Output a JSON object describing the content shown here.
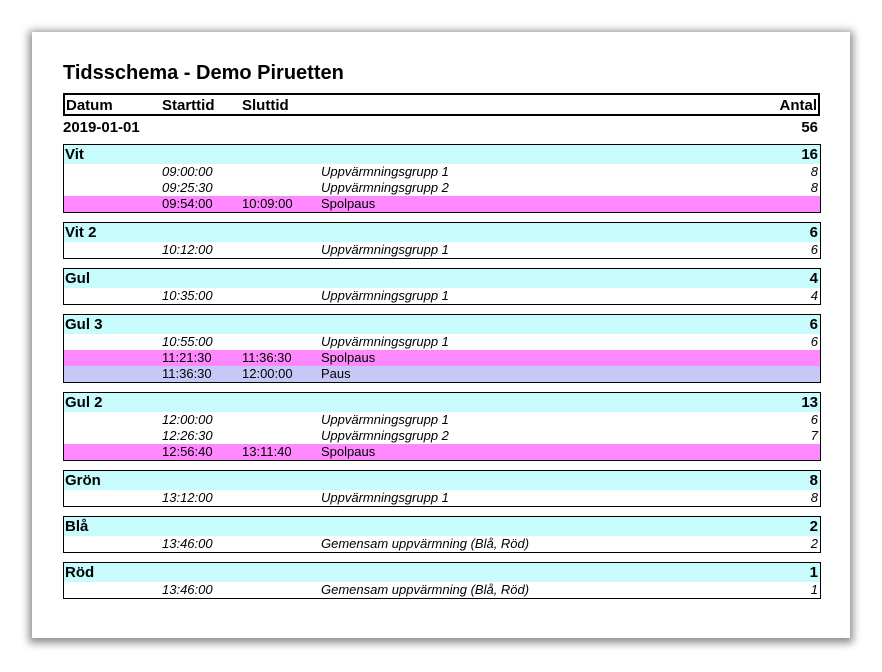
{
  "title": "Tidsschema - Demo Piruetten",
  "header": {
    "datum": "Datum",
    "starttid": "Starttid",
    "sluttid": "Sluttid",
    "antal": "Antal"
  },
  "date_row": {
    "date": "2019-01-01",
    "total": "56"
  },
  "groups": [
    {
      "name": "Vit",
      "count": "16",
      "rows": [
        {
          "kind": "warmup",
          "start": "09:00:00",
          "end": "",
          "desc": "Uppvärmningsgrupp 1",
          "num": "8"
        },
        {
          "kind": "warmup",
          "start": "09:25:30",
          "end": "",
          "desc": "Uppvärmningsgrupp 2",
          "num": "8"
        },
        {
          "kind": "spolpaus",
          "start": "09:54:00",
          "end": "10:09:00",
          "desc": "Spolpaus",
          "num": ""
        }
      ]
    },
    {
      "name": "Vit 2",
      "count": "6",
      "rows": [
        {
          "kind": "warmup",
          "start": "10:12:00",
          "end": "",
          "desc": "Uppvärmningsgrupp 1",
          "num": "6"
        }
      ]
    },
    {
      "name": "Gul",
      "count": "4",
      "rows": [
        {
          "kind": "warmup",
          "start": "10:35:00",
          "end": "",
          "desc": "Uppvärmningsgrupp 1",
          "num": "4"
        }
      ]
    },
    {
      "name": "Gul 3",
      "count": "6",
      "rows": [
        {
          "kind": "warmup",
          "start": "10:55:00",
          "end": "",
          "desc": "Uppvärmningsgrupp 1",
          "num": "6"
        },
        {
          "kind": "spolpaus",
          "start": "11:21:30",
          "end": "11:36:30",
          "desc": "Spolpaus",
          "num": ""
        },
        {
          "kind": "paus",
          "start": "11:36:30",
          "end": "12:00:00",
          "desc": "Paus",
          "num": ""
        }
      ]
    },
    {
      "name": "Gul 2",
      "count": "13",
      "rows": [
        {
          "kind": "warmup",
          "start": "12:00:00",
          "end": "",
          "desc": "Uppvärmningsgrupp 1",
          "num": "6"
        },
        {
          "kind": "warmup",
          "start": "12:26:30",
          "end": "",
          "desc": "Uppvärmningsgrupp 2",
          "num": "7"
        },
        {
          "kind": "spolpaus",
          "start": "12:56:40",
          "end": "13:11:40",
          "desc": "Spolpaus",
          "num": ""
        }
      ]
    },
    {
      "name": "Grön",
      "count": "8",
      "rows": [
        {
          "kind": "warmup",
          "start": "13:12:00",
          "end": "",
          "desc": "Uppvärmningsgrupp 1",
          "num": "8"
        }
      ]
    },
    {
      "name": "Blå",
      "count": "2",
      "rows": [
        {
          "kind": "warmup",
          "start": "13:46:00",
          "end": "",
          "desc": "Gemensam uppvärmning (Blå, Röd)",
          "num": "2"
        }
      ]
    },
    {
      "name": "Röd",
      "count": "1",
      "rows": [
        {
          "kind": "warmup",
          "start": "13:46:00",
          "end": "",
          "desc": "Gemensam uppvärmning (Blå, Röd)",
          "num": "1"
        }
      ]
    }
  ],
  "colors": {
    "group_header": "#c8fcfc",
    "spolpaus": "#ff88ff",
    "paus": "#c8c8f8"
  }
}
